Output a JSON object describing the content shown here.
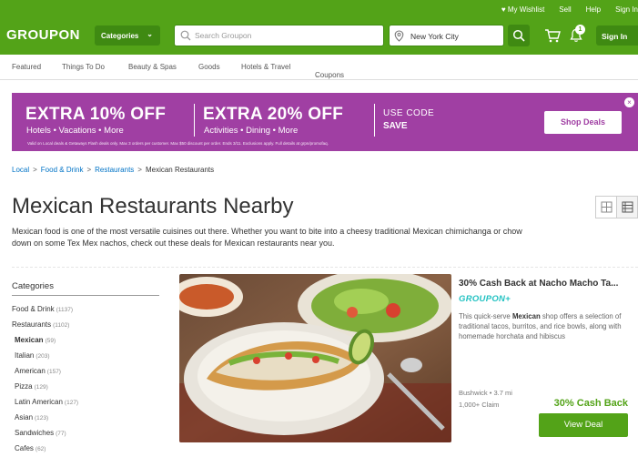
{
  "topbar": {
    "wishlist": "My Wishlist",
    "sell": "Sell",
    "help": "Help",
    "signin": "Sign In"
  },
  "header": {
    "logo": "GROUPON",
    "categories_label": "Categories",
    "search_placeholder": "Search Groupon",
    "location": "New York City",
    "notification_count": "1",
    "signin_label": "Sign In"
  },
  "catnav": {
    "items": [
      "Featured",
      "Things To Do",
      "Beauty & Spas",
      "Goods",
      "Hotels & Travel",
      "Coupons"
    ]
  },
  "banner": {
    "headline_left": "EXTRA 10% OFF",
    "sub_left": "Hotels • Vacations • More",
    "headline_right": "EXTRA 20% OFF",
    "sub_right": "Activities • Dining • More",
    "use_code": "USE CODE",
    "code": "SAVE",
    "fine_print": "Valid on Local deals & Getaways Flash deals only. Max 3 orders per customer. Max $50 discount per order. Ends 3/11. Exclusions apply. Full details at grpn/promofaq.",
    "cta": "Shop Deals",
    "accent_color": "#a03fa3"
  },
  "breadcrumb": {
    "items": [
      "Local",
      "Food & Drink",
      "Restaurants",
      "Mexican Restaurants"
    ],
    "separator": ">"
  },
  "page": {
    "title": "Mexican Restaurants Nearby",
    "description": "Mexican food is one of the most versatile cuisines out there. Whether you want to bite into a cheesy traditional Mexican chimichanga or chow down on some Tex Mex nachos, check out these deals for Mexican restaurants near you."
  },
  "sidebar": {
    "heading": "Categories",
    "items": [
      {
        "label": "Food & Drink",
        "count": "(1137)"
      },
      {
        "label": "Restaurants",
        "count": "(1102)"
      },
      {
        "label": "Mexican",
        "count": "(59)"
      },
      {
        "label": "Italian",
        "count": "(203)"
      },
      {
        "label": "American",
        "count": "(157)"
      },
      {
        "label": "Pizza",
        "count": "(129)"
      },
      {
        "label": "Latin American",
        "count": "(127)"
      },
      {
        "label": "Asian",
        "count": "(123)"
      },
      {
        "label": "Sandwiches",
        "count": "(77)"
      },
      {
        "label": "Cafes",
        "count": "(62)"
      }
    ]
  },
  "deal": {
    "title": "30% Cash Back at Nacho Macho Ta...",
    "badge": "GROUPON+",
    "desc_pre": "This quick-serve ",
    "desc_bold": "Mexican",
    "desc_post": " shop offers a selection of traditional tacos, burritos, and rice bowls, along with homemade horchata and hibiscus",
    "location": "Bushwick • 3.7 mi",
    "claims": "1,000+ Claim",
    "cashback": "30% Cash Back",
    "cta": "View Deal"
  },
  "colors": {
    "brand_green": "#53a318",
    "dark_green": "#3f8a12",
    "link_blue": "#0073c6",
    "groupon_plus": "#20c1c1"
  },
  "icons": [
    "heart-icon",
    "search-icon",
    "location-pin-icon",
    "cart-icon",
    "bell-icon",
    "chevron-down-icon",
    "close-icon",
    "grid-view-icon",
    "list-view-icon"
  ]
}
